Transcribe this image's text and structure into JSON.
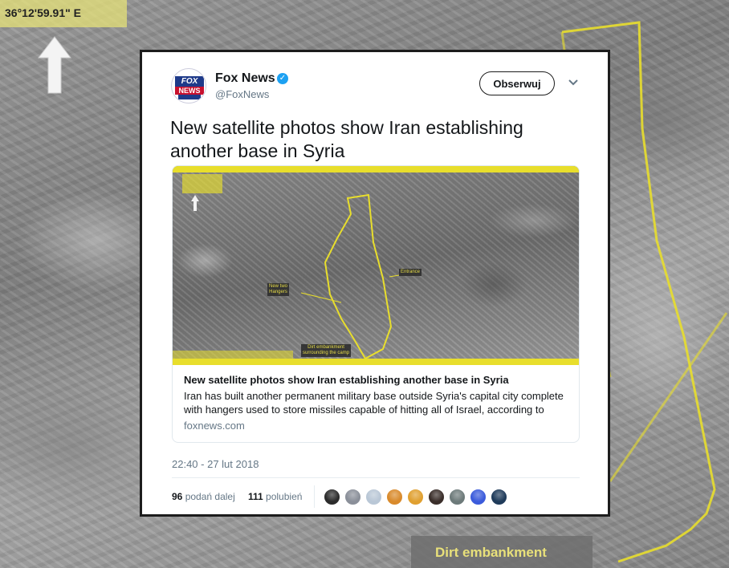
{
  "background": {
    "coordinate": "36°12'59.91\" E",
    "dirt_label": "Dirt embankment",
    "highlight_color": "#e8de2c"
  },
  "tweet": {
    "user": {
      "name": "Fox News",
      "handle": "@FoxNews",
      "avatar_icon": "fox-news-logo"
    },
    "follow_label": "Obserwuj",
    "text": "New satellite photos show Iran establishing another base in Syria",
    "card": {
      "title": "New satellite photos show Iran establishing another base in Syria",
      "description": "Iran has built another permanent military base outside Syria's capital city complete with hangers used to store missiles capable of hitting all of Israel, according to We...",
      "domain": "foxnews.com"
    },
    "timestamp": "22:40 - 27 lut 2018",
    "stats": {
      "retweets_count": "96",
      "retweets_label": "podań dalej",
      "likes_count": "111",
      "likes_label": "polubień"
    },
    "liker_colors": [
      "#2b2b2b",
      "#8a8f99",
      "#b9c7d6",
      "#d98a2b",
      "#e0a030",
      "#3a2e2a",
      "#6d7a7a",
      "#3b5bdb",
      "#1f3b5a"
    ]
  }
}
